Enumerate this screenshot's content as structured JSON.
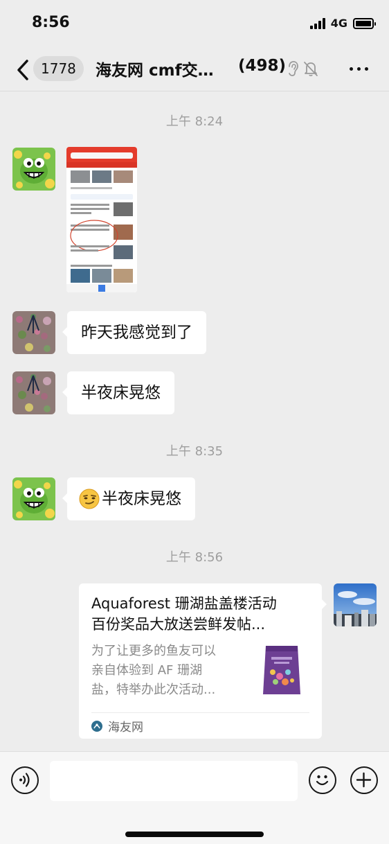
{
  "status_bar": {
    "time": "8:56",
    "network": "4G"
  },
  "nav": {
    "unread_count": "1778",
    "title": "海友网 cmf交…",
    "member_count": "(498)"
  },
  "messages": {
    "time_1": "上午 8:24",
    "text_1": "昨天我感觉到了",
    "text_2": "半夜床晃悠",
    "time_2": "上午 8:35",
    "text_3": "半夜床晃悠",
    "time_3": "上午 8:56"
  },
  "link_card": {
    "title_line1": "Aquaforest 珊湖盐盖楼活动",
    "title_line2": "百份奖品大放送尝鲜发帖...",
    "desc_line1": "为了让更多的鱼友可以",
    "desc_line2": "亲自体验到 AF 珊湖",
    "desc_line3": "盐，特举办此次活动...",
    "source": "海友网"
  },
  "input": {
    "placeholder": ""
  },
  "colors": {
    "background": "#EDEDED",
    "bubble": "#FFFFFF",
    "timestamp": "#9E9E9E",
    "news_header": "#E43C2C"
  },
  "icons": {
    "back": "chevron-left-icon",
    "ear": "ear-icon",
    "mute": "bell-mute-icon",
    "more": "ellipsis-icon",
    "voice": "voice-icon",
    "emoji": "emoji-icon",
    "plus": "plus-icon"
  }
}
